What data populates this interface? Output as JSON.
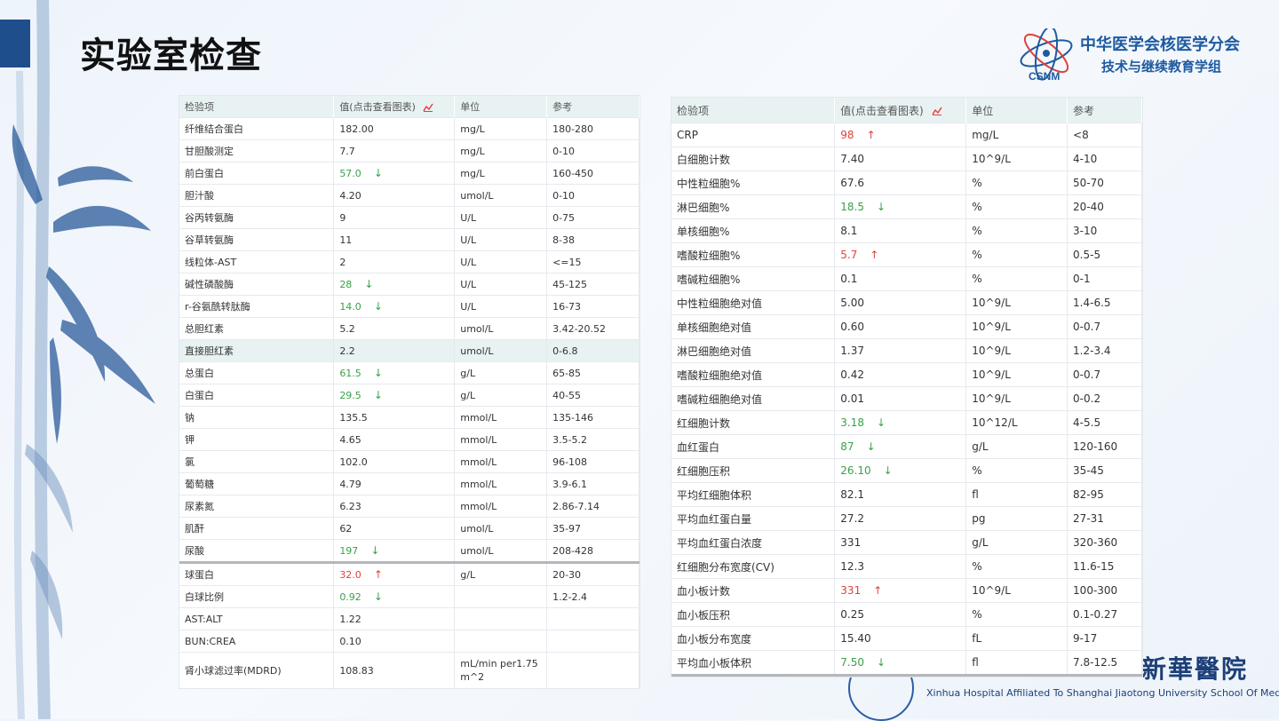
{
  "slide": {
    "title": "实验室检查",
    "org_line1": "中华医学会核医学分会",
    "org_line2": "技术与继续教育学组",
    "logo_text": "CSNM",
    "watermark_cn": "新華醫院",
    "watermark_en": "Xinhua Hospital Affiliated To Shanghai Jiaotong University School Of Medicine",
    "accent_color": "#1f4e8c",
    "up_color": "#e0413a",
    "down_color": "#3aa04a"
  },
  "headers": {
    "item": "检验项",
    "value": "值(点击查看图表)",
    "unit": "单位",
    "ref": "参考"
  },
  "left_rows": [
    {
      "item": "纤维结合蛋白",
      "value": "182.00",
      "flag": "",
      "unit": "mg/L",
      "ref": "180-280"
    },
    {
      "item": "甘胆酸测定",
      "value": "7.7",
      "flag": "",
      "unit": "mg/L",
      "ref": "0-10"
    },
    {
      "item": "前白蛋白",
      "value": "57.0",
      "flag": "down",
      "unit": "mg/L",
      "ref": "160-450"
    },
    {
      "item": "胆汁酸",
      "value": "4.20",
      "flag": "",
      "unit": "umol/L",
      "ref": "0-10"
    },
    {
      "item": "谷丙转氨酶",
      "value": "9",
      "flag": "",
      "unit": "U/L",
      "ref": "0-75"
    },
    {
      "item": "谷草转氨酶",
      "value": "11",
      "flag": "",
      "unit": "U/L",
      "ref": "8-38"
    },
    {
      "item": "线粒体-AST",
      "value": "2",
      "flag": "",
      "unit": "U/L",
      "ref": "<=15"
    },
    {
      "item": "碱性磷酸酶",
      "value": "28",
      "flag": "down",
      "unit": "U/L",
      "ref": "45-125"
    },
    {
      "item": "r-谷氨酰转肽酶",
      "value": "14.0",
      "flag": "down",
      "unit": "U/L",
      "ref": "16-73"
    },
    {
      "item": "总胆红素",
      "value": "5.2",
      "flag": "",
      "unit": "umol/L",
      "ref": "3.42-20.52"
    },
    {
      "item": "直接胆红素",
      "value": "2.2",
      "flag": "",
      "unit": "umol/L",
      "ref": "0-6.8"
    },
    {
      "item": "总蛋白",
      "value": "61.5",
      "flag": "down",
      "unit": "g/L",
      "ref": "65-85"
    },
    {
      "item": "白蛋白",
      "value": "29.5",
      "flag": "down",
      "unit": "g/L",
      "ref": "40-55"
    },
    {
      "item": "钠",
      "value": "135.5",
      "flag": "",
      "unit": "mmol/L",
      "ref": "135-146"
    },
    {
      "item": "钾",
      "value": "4.65",
      "flag": "",
      "unit": "mmol/L",
      "ref": "3.5-5.2"
    },
    {
      "item": "氯",
      "value": "102.0",
      "flag": "",
      "unit": "mmol/L",
      "ref": "96-108"
    },
    {
      "item": "葡萄糖",
      "value": "4.79",
      "flag": "",
      "unit": "mmol/L",
      "ref": "3.9-6.1"
    },
    {
      "item": "尿素氮",
      "value": "6.23",
      "flag": "",
      "unit": "mmol/L",
      "ref": "2.86-7.14"
    },
    {
      "item": "肌酐",
      "value": "62",
      "flag": "",
      "unit": "umol/L",
      "ref": "35-97"
    },
    {
      "item": "尿酸",
      "value": "197",
      "flag": "down",
      "unit": "umol/L",
      "ref": "208-428"
    },
    {
      "item": "球蛋白",
      "value": "32.0",
      "flag": "up",
      "unit": "g/L",
      "ref": "20-30"
    },
    {
      "item": "白球比例",
      "value": "0.92",
      "flag": "down",
      "unit": "",
      "ref": "1.2-2.4"
    },
    {
      "item": "AST:ALT",
      "value": "1.22",
      "flag": "",
      "unit": "",
      "ref": ""
    },
    {
      "item": "BUN:CREA",
      "value": "0.10",
      "flag": "",
      "unit": "",
      "ref": ""
    },
    {
      "item": "肾小球滤过率(MDRD)",
      "value": "108.83",
      "flag": "",
      "unit": "mL/min per1.75 m^2",
      "ref": ""
    }
  ],
  "right_rows": [
    {
      "item": "CRP",
      "value": "98",
      "flag": "up",
      "unit": "mg/L",
      "ref": "<8"
    },
    {
      "item": "白细胞计数",
      "value": "7.40",
      "flag": "",
      "unit": "10^9/L",
      "ref": "4-10"
    },
    {
      "item": "中性粒细胞%",
      "value": "67.6",
      "flag": "",
      "unit": "%",
      "ref": "50-70"
    },
    {
      "item": "淋巴细胞%",
      "value": "18.5",
      "flag": "down",
      "unit": "%",
      "ref": "20-40"
    },
    {
      "item": "单核细胞%",
      "value": "8.1",
      "flag": "",
      "unit": "%",
      "ref": "3-10"
    },
    {
      "item": "嗜酸粒细胞%",
      "value": "5.7",
      "flag": "up",
      "unit": "%",
      "ref": "0.5-5"
    },
    {
      "item": "嗜碱粒细胞%",
      "value": "0.1",
      "flag": "",
      "unit": "%",
      "ref": "0-1"
    },
    {
      "item": "中性粒细胞绝对值",
      "value": "5.00",
      "flag": "",
      "unit": "10^9/L",
      "ref": "1.4-6.5"
    },
    {
      "item": "单核细胞绝对值",
      "value": "0.60",
      "flag": "",
      "unit": "10^9/L",
      "ref": "0-0.7"
    },
    {
      "item": "淋巴细胞绝对值",
      "value": "1.37",
      "flag": "",
      "unit": "10^9/L",
      "ref": "1.2-3.4"
    },
    {
      "item": "嗜酸粒细胞绝对值",
      "value": "0.42",
      "flag": "",
      "unit": "10^9/L",
      "ref": "0-0.7"
    },
    {
      "item": "嗜碱粒细胞绝对值",
      "value": "0.01",
      "flag": "",
      "unit": "10^9/L",
      "ref": "0-0.2"
    },
    {
      "item": "红细胞计数",
      "value": "3.18",
      "flag": "down",
      "unit": "10^12/L",
      "ref": "4-5.5"
    },
    {
      "item": "血红蛋白",
      "value": "87",
      "flag": "down",
      "unit": "g/L",
      "ref": "120-160"
    },
    {
      "item": "红细胞压积",
      "value": "26.10",
      "flag": "down",
      "unit": "%",
      "ref": "35-45"
    },
    {
      "item": "平均红细胞体积",
      "value": "82.1",
      "flag": "",
      "unit": "fl",
      "ref": "82-95"
    },
    {
      "item": "平均血红蛋白量",
      "value": "27.2",
      "flag": "",
      "unit": "pg",
      "ref": "27-31"
    },
    {
      "item": "平均血红蛋白浓度",
      "value": "331",
      "flag": "",
      "unit": "g/L",
      "ref": "320-360"
    },
    {
      "item": "红细胞分布宽度(CV)",
      "value": "12.3",
      "flag": "",
      "unit": "%",
      "ref": "11.6-15"
    },
    {
      "item": "血小板计数",
      "value": "331",
      "flag": "up",
      "unit": "10^9/L",
      "ref": "100-300"
    },
    {
      "item": "血小板压积",
      "value": "0.25",
      "flag": "",
      "unit": "%",
      "ref": "0.1-0.27"
    },
    {
      "item": "血小板分布宽度",
      "value": "15.40",
      "flag": "",
      "unit": "fL",
      "ref": "9-17"
    },
    {
      "item": "平均血小板体积",
      "value": "7.50",
      "flag": "down",
      "unit": "fl",
      "ref": "7.8-12.5"
    }
  ],
  "left_highlight_index": 10,
  "left_separator_index": 20,
  "arrow_up": "↑",
  "arrow_down": "↓"
}
